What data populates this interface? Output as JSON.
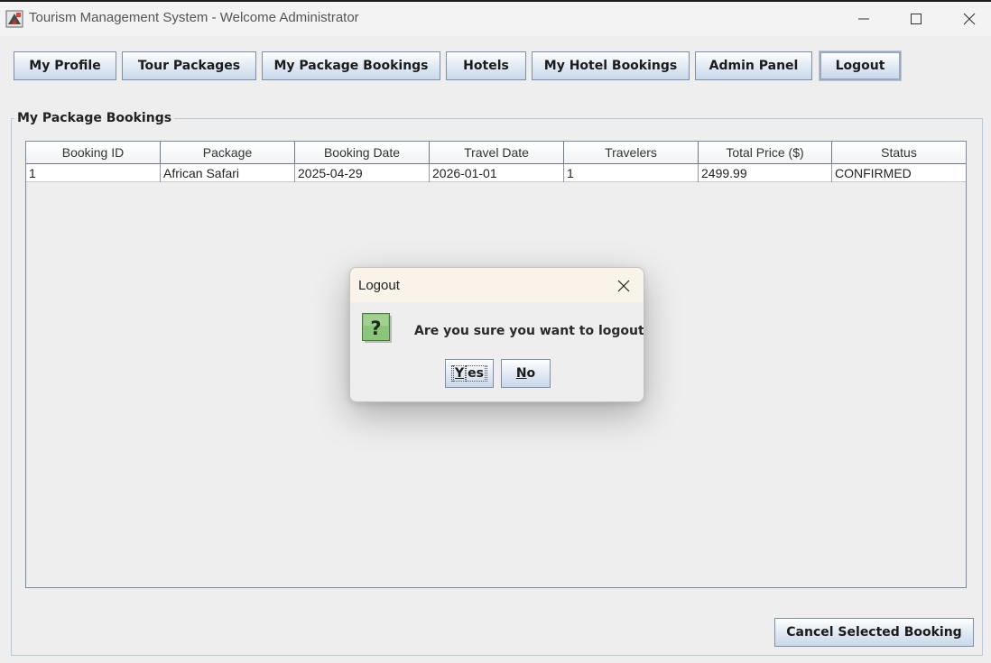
{
  "window": {
    "title": "Tourism Management System - Welcome Administrator"
  },
  "toolbar": {
    "buttons": [
      {
        "label": "My Profile"
      },
      {
        "label": "Tour Packages"
      },
      {
        "label": "My Package Bookings"
      },
      {
        "label": "Hotels"
      },
      {
        "label": "My Hotel Bookings"
      },
      {
        "label": "Admin Panel"
      },
      {
        "label": "Logout"
      }
    ]
  },
  "panel": {
    "title": "My Package Bookings"
  },
  "table": {
    "columns": [
      "Booking ID",
      "Package",
      "Booking Date",
      "Travel Date",
      "Travelers",
      "Total Price ($)",
      "Status"
    ],
    "rows": [
      [
        "1",
        "African Safari",
        "2025-04-29",
        "2026-01-01",
        "1",
        "2499.99",
        "CONFIRMED"
      ]
    ]
  },
  "actions": {
    "cancel_label": "Cancel Selected Booking"
  },
  "dialog": {
    "title": "Logout",
    "message": "Are you sure you want to logout?",
    "yes_mnemonic": "Y",
    "yes_rest": "es",
    "no_mnemonic": "N",
    "no_rest": "o",
    "icon": "question-icon"
  },
  "colors": {
    "button_border": "#7f8ea6",
    "dialog_titlebar": "#f9f3ea",
    "question_icon_green": "#7bb46a"
  }
}
